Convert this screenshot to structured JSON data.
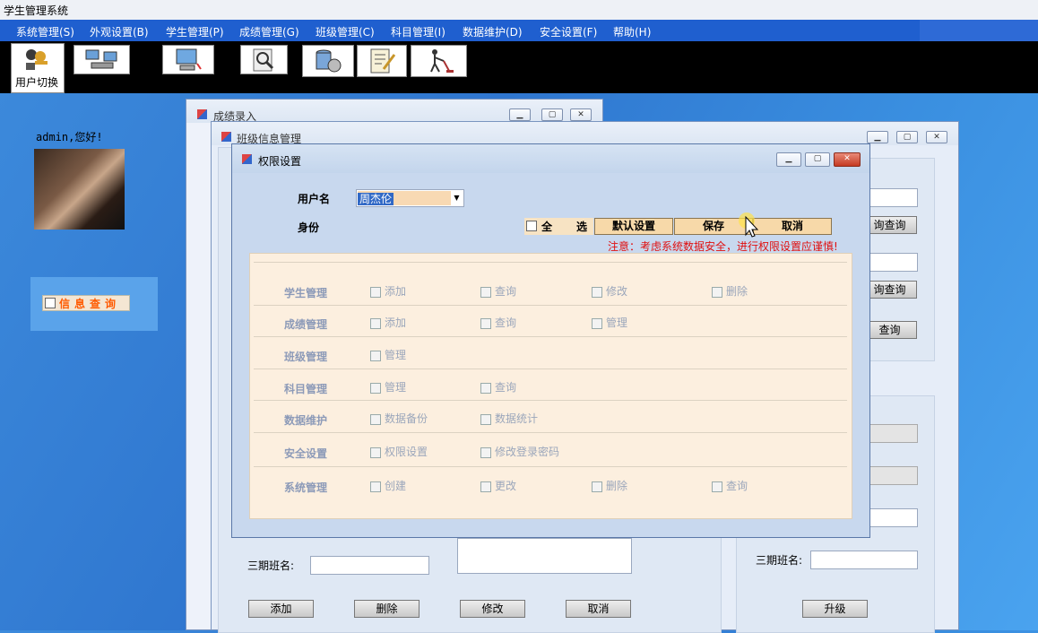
{
  "app_title": "学生管理系统",
  "menu": [
    "系统管理(S)",
    "外观设置(B)",
    "学生管理(P)",
    "成绩管理(G)",
    "班级管理(C)",
    "科目管理(I)",
    "数据维护(D)",
    "安全设置(F)",
    "帮助(H)"
  ],
  "toolbar": {
    "user_switch_label": "用户切换"
  },
  "left": {
    "greeting": "admin,您好!",
    "info_query": "信息查询"
  },
  "win_score": {
    "title": "成绩录入"
  },
  "win_class": {
    "title": "班级信息管理",
    "third_label": "三期班名:",
    "add": "添加",
    "delete": "删除",
    "modify": "修改",
    "cancel": "取消"
  },
  "win_right": {
    "query1": "询查询",
    "query2": "询查询",
    "query3": "查询",
    "third_label": "三期班名:",
    "upgrade": "升级"
  },
  "perm": {
    "title": "权限设置",
    "username_label": "用户名",
    "username_value": "周杰伦",
    "role_label": "身份",
    "select_all_1": "全",
    "select_all_2": "选",
    "default_btn": "默认设置",
    "save_btn": "保存",
    "cancel_btn": "取消",
    "warning": "注意：考虑系统数据安全，进行权限设置应谨慎!",
    "rows": [
      {
        "label": "学生管理",
        "items": [
          "添加",
          "查询",
          "修改",
          "删除"
        ]
      },
      {
        "label": "成绩管理",
        "items": [
          "添加",
          "查询",
          "管理"
        ]
      },
      {
        "label": "班级管理",
        "items": [
          "管理"
        ]
      },
      {
        "label": "科目管理",
        "items": [
          "管理",
          "查询"
        ]
      },
      {
        "label": "数据维护",
        "items": [
          "数据备份",
          "数据统计"
        ]
      },
      {
        "label": "安全设置",
        "items": [
          "权限设置",
          "修改登录密码"
        ]
      },
      {
        "label": "系统管理",
        "items": [
          "创建",
          "更改",
          "删除",
          "查询"
        ]
      }
    ]
  }
}
